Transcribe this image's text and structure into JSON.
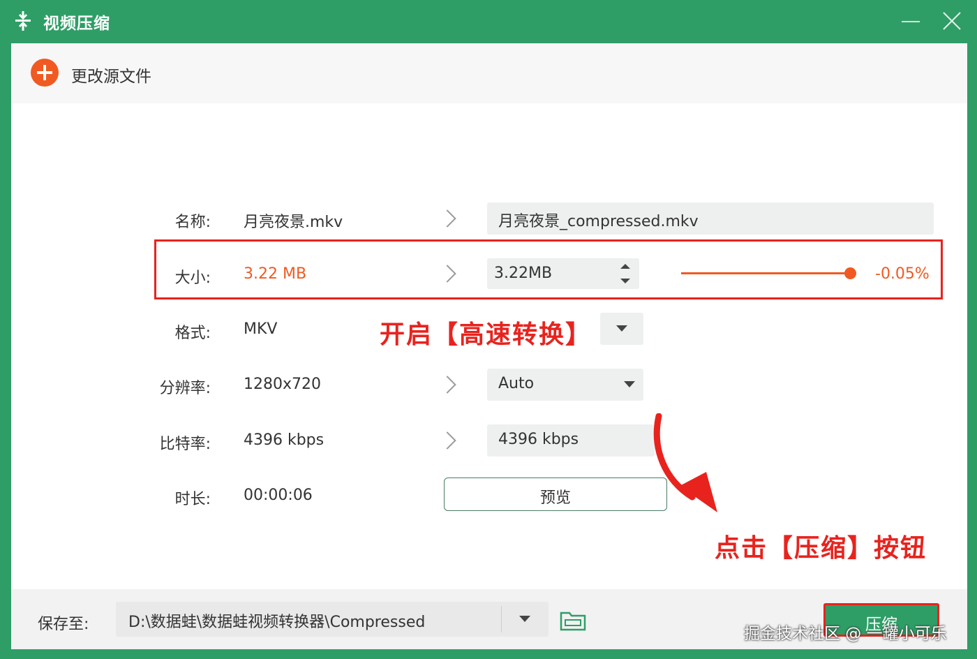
{
  "window": {
    "title": "视频压缩"
  },
  "toolbar": {
    "change_source_label": "更改源文件"
  },
  "rows": {
    "name": {
      "label": "名称:",
      "source": "月亮夜景.mkv",
      "target": "月亮夜景_compressed.mkv"
    },
    "size": {
      "label": "大小:",
      "source": "3.22 MB",
      "target": "3.22MB",
      "percent": "-0.05%",
      "slider_level": 0.98
    },
    "format": {
      "label": "格式:",
      "source": "MKV"
    },
    "resolution": {
      "label": "分辨率:",
      "source": "1280x720",
      "target": "Auto"
    },
    "bitrate": {
      "label": "比特率:",
      "source": "4396 kbps",
      "target": "4396 kbps"
    },
    "duration": {
      "label": "时长:",
      "source": "00:00:06",
      "preview_label": "预览"
    }
  },
  "annotations": {
    "speed_hint": "开启【高速转换】",
    "compress_hint": "点击【压缩】按钮"
  },
  "footer": {
    "save_label": "保存至:",
    "save_path": "D:\\数据蛙\\数据蛙视频转换器\\Compressed",
    "compress_label": "压缩"
  },
  "watermark": "掘金技术社区 @ 一罐小可乐",
  "colors": {
    "brand_green": "#2e9e66",
    "accent_orange": "#f05a22",
    "annotation_red": "#e8231e"
  }
}
